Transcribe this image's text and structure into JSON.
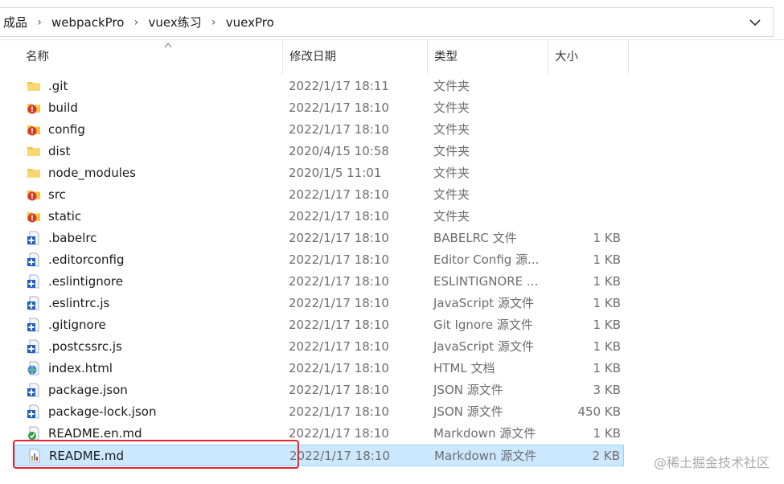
{
  "breadcrumb": [
    "成品",
    "webpackPro",
    "vuex练习",
    "vuexPro"
  ],
  "columns": {
    "name": "名称",
    "modified": "修改日期",
    "type": "类型",
    "size": "大小"
  },
  "files": [
    {
      "name": ".git",
      "modified": "2022/1/17 18:11",
      "type": "文件夹",
      "size": "",
      "icon": "folder-icon"
    },
    {
      "name": "build",
      "modified": "2022/1/17 18:10",
      "type": "文件夹",
      "size": "",
      "icon": "folder-error-icon"
    },
    {
      "name": "config",
      "modified": "2022/1/17 18:10",
      "type": "文件夹",
      "size": "",
      "icon": "folder-error-icon"
    },
    {
      "name": "dist",
      "modified": "2020/4/15 10:58",
      "type": "文件夹",
      "size": "",
      "icon": "folder-icon"
    },
    {
      "name": "node_modules",
      "modified": "2020/1/5 11:01",
      "type": "文件夹",
      "size": "",
      "icon": "folder-icon"
    },
    {
      "name": "src",
      "modified": "2022/1/17 18:10",
      "type": "文件夹",
      "size": "",
      "icon": "folder-error-icon"
    },
    {
      "name": "static",
      "modified": "2022/1/17 18:10",
      "type": "文件夹",
      "size": "",
      "icon": "folder-error-icon"
    },
    {
      "name": ".babelrc",
      "modified": "2022/1/17 18:10",
      "type": "BABELRC 文件",
      "size": "1 KB",
      "icon": "file-icon"
    },
    {
      "name": ".editorconfig",
      "modified": "2022/1/17 18:10",
      "type": "Editor Config 源...",
      "size": "1 KB",
      "icon": "file-icon"
    },
    {
      "name": ".eslintignore",
      "modified": "2022/1/17 18:10",
      "type": "ESLINTIGNORE ...",
      "size": "1 KB",
      "icon": "file-icon"
    },
    {
      "name": ".eslintrc.js",
      "modified": "2022/1/17 18:10",
      "type": "JavaScript 源文件",
      "size": "1 KB",
      "icon": "file-icon"
    },
    {
      "name": ".gitignore",
      "modified": "2022/1/17 18:10",
      "type": "Git Ignore 源文件",
      "size": "1 KB",
      "icon": "file-icon"
    },
    {
      "name": ".postcssrc.js",
      "modified": "2022/1/17 18:10",
      "type": "JavaScript 源文件",
      "size": "1 KB",
      "icon": "file-icon"
    },
    {
      "name": "index.html",
      "modified": "2022/1/17 18:10",
      "type": "HTML 文档",
      "size": "1 KB",
      "icon": "html-file-icon"
    },
    {
      "name": "package.json",
      "modified": "2022/1/17 18:10",
      "type": "JSON 源文件",
      "size": "3 KB",
      "icon": "file-icon"
    },
    {
      "name": "package-lock.json",
      "modified": "2022/1/17 18:10",
      "type": "JSON 源文件",
      "size": "450 KB",
      "icon": "file-icon"
    },
    {
      "name": "README.en.md",
      "modified": "2022/1/17 18:10",
      "type": "Markdown 源文件",
      "size": "1 KB",
      "icon": "md-check-icon"
    },
    {
      "name": "README.md",
      "modified": "2022/1/17 18:10",
      "type": "Markdown 源文件",
      "size": "2 KB",
      "icon": "md-file-icon",
      "selected": true
    }
  ],
  "watermark": "@稀土掘金技术社区",
  "colors": {
    "selection": "#cce8ff",
    "highlight": "#e8232c",
    "folder": "#f5c342"
  }
}
